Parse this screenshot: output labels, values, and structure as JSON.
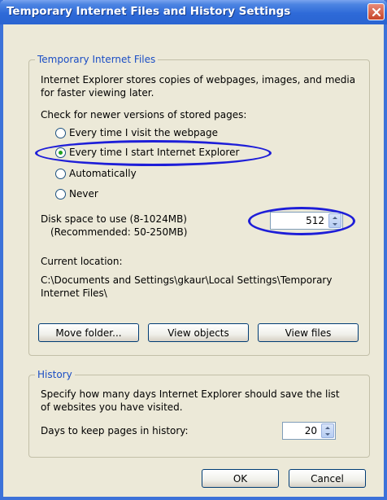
{
  "title": "Temporary Internet Files and History Settings",
  "temp_files": {
    "group_label": "Temporary Internet Files",
    "description_line1": "Internet Explorer stores copies of webpages, images, and media",
    "description_line2": "for faster viewing later.",
    "check_label": "Check for newer versions of stored pages:",
    "options": [
      {
        "label": "Every time I visit the webpage",
        "checked": false
      },
      {
        "label": "Every time I start Internet Explorer",
        "checked": true
      },
      {
        "label": "Automatically",
        "checked": false
      },
      {
        "label": "Never",
        "checked": false
      }
    ],
    "disk_label_line1": "Disk space to use (8-1024MB)",
    "disk_label_line2": "(Recommended: 50-250MB)",
    "disk_value": "512",
    "location_label": "Current location:",
    "location_line1": "C:\\Documents and Settings\\gkaur\\Local Settings\\Temporary",
    "location_line2": "Internet Files\\",
    "buttons": {
      "move_folder": "Move folder...",
      "view_objects": "View objects",
      "view_files": "View files"
    }
  },
  "history": {
    "group_label": "History",
    "description_line1": "Specify how many days Internet Explorer should save the list",
    "description_line2": "of websites you have visited.",
    "days_label": "Days to keep pages in history:",
    "days_value": "20"
  },
  "footer": {
    "ok": "OK",
    "cancel": "Cancel"
  },
  "colors": {
    "titlebar": "#2E6AD8",
    "window_bg": "#ECE9D8",
    "group_label": "#1A4DC4",
    "annotation": "#1E1ED8"
  }
}
